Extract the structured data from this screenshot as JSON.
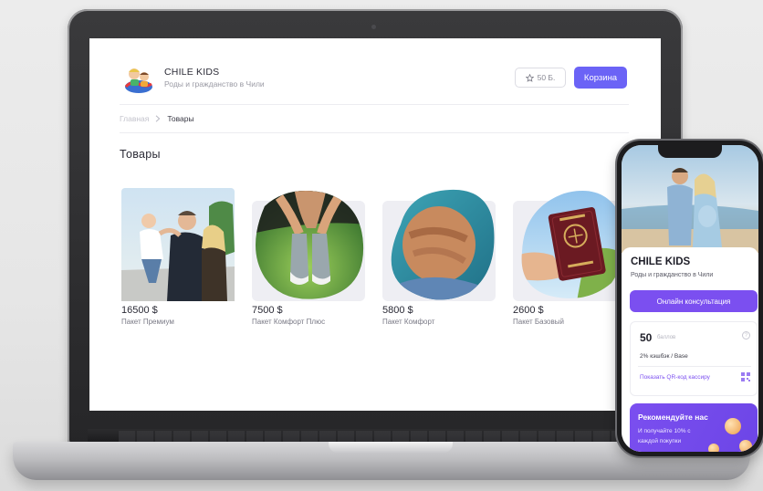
{
  "header": {
    "brand_title": "CHILE KIDS",
    "brand_subtitle": "Роды и гражданство в Чили",
    "points_label": "50 Б.",
    "cart_label": "Корзина"
  },
  "breadcrumb": {
    "home": "Главная",
    "current": "Товары"
  },
  "page_title": "Товары",
  "products": [
    {
      "price": "16500 $",
      "name": "Пакет Премиум"
    },
    {
      "price": "7500 $",
      "name": "Пакет Комфорт Плюс"
    },
    {
      "price": "5800 $",
      "name": "Пакет Комфорт"
    },
    {
      "price": "2600 $",
      "name": "Пакет Базовый"
    }
  ],
  "phone": {
    "brand_title": "CHILE KIDS",
    "brand_subtitle": "Роды и гражданство в Чили",
    "consult_label": "Онлайн консультация",
    "points_value": "50",
    "points_unit": "баллов",
    "help_glyph": "?",
    "cashback_text": "2% кэшбэк / Base",
    "qr_link": "Показать QR-код кассиру",
    "referral_title": "Рекомендуйте нас",
    "referral_text": "И получайте 10% с каждой покупки"
  },
  "icons": {
    "star": "star-icon",
    "chevron": "chevron-right-icon",
    "qr": "qr-code-icon",
    "help": "help-icon"
  },
  "colors": {
    "accent_blue": "#6b63f6",
    "accent_purple": "#7b4ff0",
    "text_dark": "#2a2a35",
    "text_muted": "#9a9aa4"
  }
}
